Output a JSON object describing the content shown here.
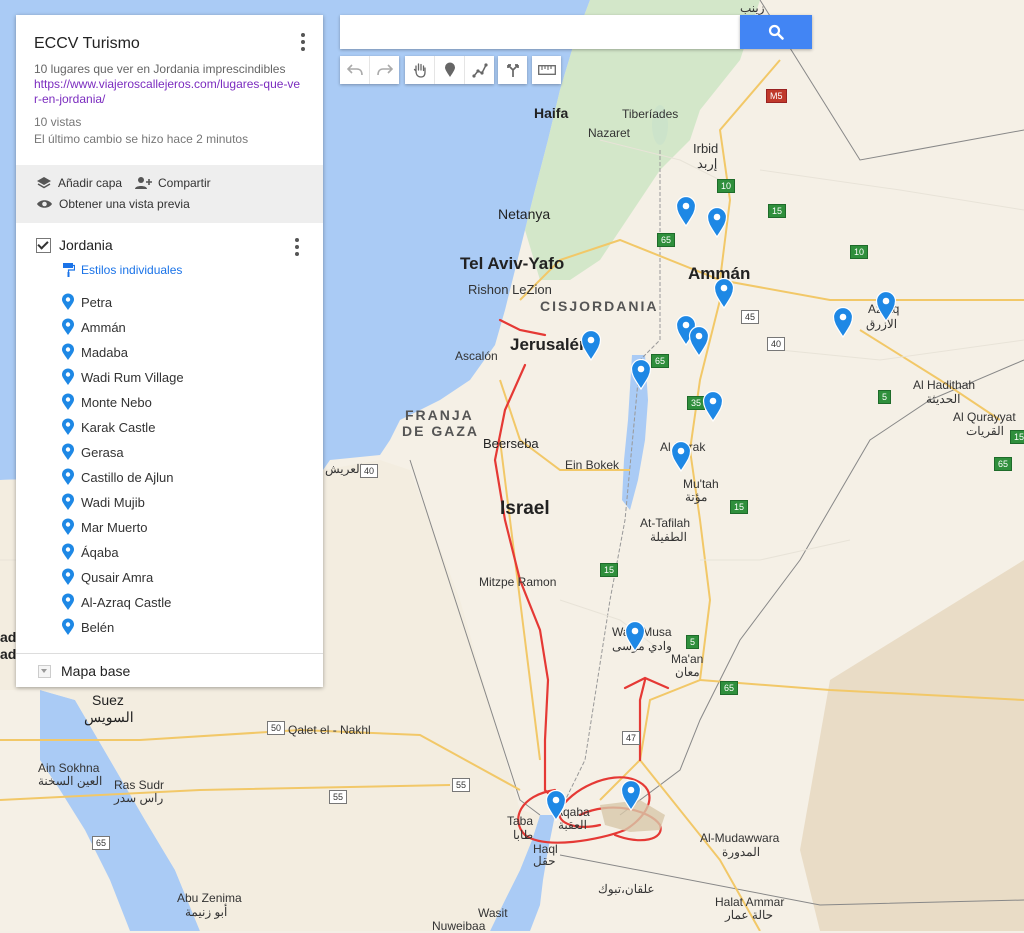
{
  "panel": {
    "title": "ECCV Turismo",
    "description": "10 lugares que ver en Jordania imprescindibles",
    "link": "https://www.viajeroscallejeros.com/lugares-que-ver-en-jordania/",
    "views": "10 vistas",
    "last_change": "El último cambio se hizo hace 2 minutos",
    "actions": {
      "add_layer": "Añadir capa",
      "share": "Compartir",
      "preview": "Obtener una vista previa"
    },
    "layer": {
      "name": "Jordania",
      "styles": "Estilos individuales",
      "places": [
        "Petra",
        "Ammán",
        "Madaba",
        "Wadi Rum Village",
        "Monte Nebo",
        "Karak Castle",
        "Gerasa",
        "Castillo de Ajlun",
        "Wadi Mujib",
        "Mar Muerto",
        "Áqaba",
        "Qusair Amra",
        "Al-Azraq Castle",
        "Belén"
      ]
    },
    "base_map": "Mapa base"
  },
  "search": {
    "placeholder": "",
    "value": ""
  },
  "toolbar": {
    "icons": [
      "undo-icon",
      "redo-icon",
      "hand-icon",
      "marker-icon",
      "draw-line-icon",
      "directions-icon",
      "ruler-icon"
    ]
  },
  "map": {
    "labels": {
      "haifa": "Haifa",
      "nazaret": "Nazaret",
      "tiberiades": "Tiberíades",
      "irbid": "Irbid",
      "irbid_ar": "إربد",
      "netanya": "Netanya",
      "gerasa_lbl": "Gerasa",
      "telaviv": "Tel Aviv-Yafo",
      "rishon": "Rishon LeZion",
      "amman": "Ammán",
      "cisjordania": "CISJORDANIA",
      "jerusalen": "Jerusalén",
      "ascalon": "Ascalón",
      "azraq": "Azraq",
      "azraq_ar": "الأزرق",
      "hadithah": "Al Hadithah",
      "hadithah_ar": "الحديثة",
      "qurayyat": "Al Qurayyat",
      "qurayyat_ar": "القريات",
      "franja": "FRANJA",
      "gaza": "DE GAZA",
      "beerseba": "Beerseba",
      "einbokek": "Ein Bokek",
      "alkarak": "Al Karak",
      "mutah": "Mu'tah",
      "mutah_ar": "مؤتة",
      "israel": "Israel",
      "tafilah": "At-Tafilah",
      "tafilah_ar": "الطفيلة",
      "alarish_ar": "العريش",
      "mitzpe": "Mitzpe Ramon",
      "wadimusa": "Wadi Musa",
      "wadimusa_ar": "وادي موسى",
      "maan": "Ma'an",
      "maan_ar": "معان",
      "suez": "Suez",
      "suez_ar": "السويس",
      "qalet": "Qalet el - Nakhl",
      "ainsokhna": "Ain Sokhna",
      "ainsokhna_ar": "العين السخنة",
      "rassudr": "Ras Sudr",
      "rassudr_ar": "راس سدر",
      "taba": "Taba",
      "taba_ar": "طابا",
      "aqaba": "Aqaba",
      "aqaba_ar": "العقبة",
      "mudawwara": "Al-Mudawwara",
      "mudawwara_ar": "المدورة",
      "haql": "Haql",
      "haql_ar": "حقل",
      "alqan_ar": "علقان،تبوك",
      "abuzenima": "Abu Zenima",
      "abuzenima_ar": "أبو زنيمة",
      "halatammar": "Halat Ammar",
      "halatammar_ar": "حالة عمار",
      "wasit": "Wasit",
      "nuweibaa": "Nuweibaa",
      "zaynab_ar": "زينب",
      "ad": "ad",
      "ado": "ado"
    },
    "shields": [
      "M5",
      "10",
      "15",
      "65",
      "10",
      "45",
      "40",
      "35",
      "65",
      "15",
      "15",
      "65",
      "5",
      "5",
      "47",
      "40",
      "50",
      "55",
      "55",
      "65",
      "65",
      "15"
    ]
  },
  "colors": {
    "accent": "#4285f4",
    "pin": "#1e88e5",
    "annotation": "#e53935",
    "link": "#7b2cbf"
  }
}
